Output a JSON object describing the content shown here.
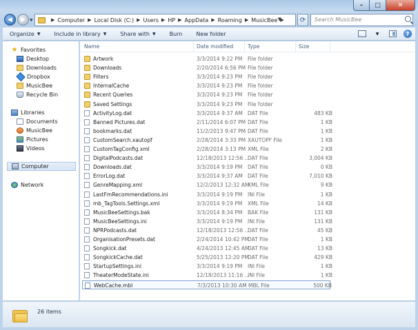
{
  "window": {
    "controls": [
      "minimize",
      "maximize",
      "close"
    ]
  },
  "address": {
    "breadcrumbs": [
      "Computer",
      "Local Disk (C:)",
      "Users",
      "HP",
      "AppData",
      "Roaming",
      "MusicBee"
    ]
  },
  "search": {
    "placeholder": "Search MusicBee"
  },
  "toolbar": {
    "organize": "Organize",
    "include_in_library": "Include in library",
    "share_with": "Share with",
    "burn": "Burn",
    "new_folder": "New folder"
  },
  "nav": {
    "favorites": "Favorites",
    "desktop": "Desktop",
    "downloads": "Downloads",
    "dropbox": "Dropbox",
    "musicbee": "MusicBee",
    "recycle_bin": "Recycle Bin",
    "libraries": "Libraries",
    "documents": "Documents",
    "lib_musicbee": "MusicBee",
    "pictures": "Pictures",
    "videos": "Videos",
    "computer": "Computer",
    "network": "Network"
  },
  "columns": {
    "name": "Name",
    "date_modified": "Date modified",
    "type": "Type",
    "size": "Size"
  },
  "files": [
    {
      "name": "Artwork",
      "date": "3/3/2014 9:22 PM",
      "type": "File folder",
      "size": "",
      "kind": "folder"
    },
    {
      "name": "Downloads",
      "date": "2/20/2014 6:56 PM",
      "type": "File folder",
      "size": "",
      "kind": "folder"
    },
    {
      "name": "Filters",
      "date": "3/3/2014 9:23 PM",
      "type": "File folder",
      "size": "",
      "kind": "folder"
    },
    {
      "name": "InternalCache",
      "date": "3/3/2014 9:23 PM",
      "type": "File folder",
      "size": "",
      "kind": "folder"
    },
    {
      "name": "Recent Queries",
      "date": "3/3/2014 9:23 PM",
      "type": "File folder",
      "size": "",
      "kind": "folder"
    },
    {
      "name": "Saved Settings",
      "date": "3/3/2014 9:23 PM",
      "type": "File folder",
      "size": "",
      "kind": "folder"
    },
    {
      "name": "ActivityLog.dat",
      "date": "3/3/2014 9:37 AM",
      "type": "DAT File",
      "size": "483 KB",
      "kind": "file"
    },
    {
      "name": "Banned Pictures.dat",
      "date": "2/11/2014 6:07 PM",
      "type": "DAT File",
      "size": "1 KB",
      "kind": "file"
    },
    {
      "name": "bookmarks.dat",
      "date": "11/2/2013 9:47 PM",
      "type": "DAT File",
      "size": "1 KB",
      "kind": "file"
    },
    {
      "name": "CustomSearch.xautopf",
      "date": "2/28/2014 3:33 PM",
      "type": "XAUTOPF File",
      "size": "1 KB",
      "kind": "file"
    },
    {
      "name": "CustomTagConfig.xml",
      "date": "2/28/2014 3:13 PM",
      "type": "XML File",
      "size": "2 KB",
      "kind": "file"
    },
    {
      "name": "DigitalPodcasts.dat",
      "date": "12/18/2013 12:56 ...",
      "type": "DAT File",
      "size": "3,004 KB",
      "kind": "file"
    },
    {
      "name": "Downloads.dat",
      "date": "3/3/2014 9:19 PM",
      "type": "DAT File",
      "size": "0 KB",
      "kind": "file"
    },
    {
      "name": "ErrorLog.dat",
      "date": "3/3/2014 9:37 AM",
      "type": "DAT File",
      "size": "7,010 KB",
      "kind": "file"
    },
    {
      "name": "GenreMapping.xml",
      "date": "12/2/2013 12:32 AM",
      "type": "XML File",
      "size": "9 KB",
      "kind": "file"
    },
    {
      "name": "LastFmRecommendations.ini",
      "date": "3/3/2014 9:19 PM",
      "type": "INI File",
      "size": "1 KB",
      "kind": "file"
    },
    {
      "name": "mb_TagTools.Settings.xml",
      "date": "3/3/2014 9:19 PM",
      "type": "XML File",
      "size": "14 KB",
      "kind": "file"
    },
    {
      "name": "MusicBeeSettings.bak",
      "date": "3/3/2014 8:34 PM",
      "type": "BAK File",
      "size": "131 KB",
      "kind": "file"
    },
    {
      "name": "MusicBeeSettings.ini",
      "date": "3/3/2014 9:19 PM",
      "type": "INI File",
      "size": "131 KB",
      "kind": "file"
    },
    {
      "name": "NPRPodcasts.dat",
      "date": "12/18/2013 12:56 ...",
      "type": "DAT File",
      "size": "45 KB",
      "kind": "file"
    },
    {
      "name": "OrganisationPresets.dat",
      "date": "2/24/2014 10:42 PM",
      "type": "DAT File",
      "size": "1 KB",
      "kind": "file"
    },
    {
      "name": "Songkick.dat",
      "date": "4/24/2013 12:45 AM",
      "type": "DAT File",
      "size": "13 KB",
      "kind": "file"
    },
    {
      "name": "SongkickCache.dat",
      "date": "5/25/2013 12:20 PM",
      "type": "DAT File",
      "size": "429 KB",
      "kind": "file"
    },
    {
      "name": "StartupSettings.ini",
      "date": "3/3/2014 9:19 PM",
      "type": "INI File",
      "size": "1 KB",
      "kind": "file"
    },
    {
      "name": "TheaterModeState.ini",
      "date": "12/18/2013 11:16 ...",
      "type": "INI File",
      "size": "1 KB",
      "kind": "file"
    },
    {
      "name": "WebCache.mbl",
      "date": "7/3/2013 10:30 AM",
      "type": "MBL File",
      "size": "500 KB",
      "kind": "file",
      "selected": true
    }
  ],
  "details": {
    "item_count": "26 items"
  }
}
